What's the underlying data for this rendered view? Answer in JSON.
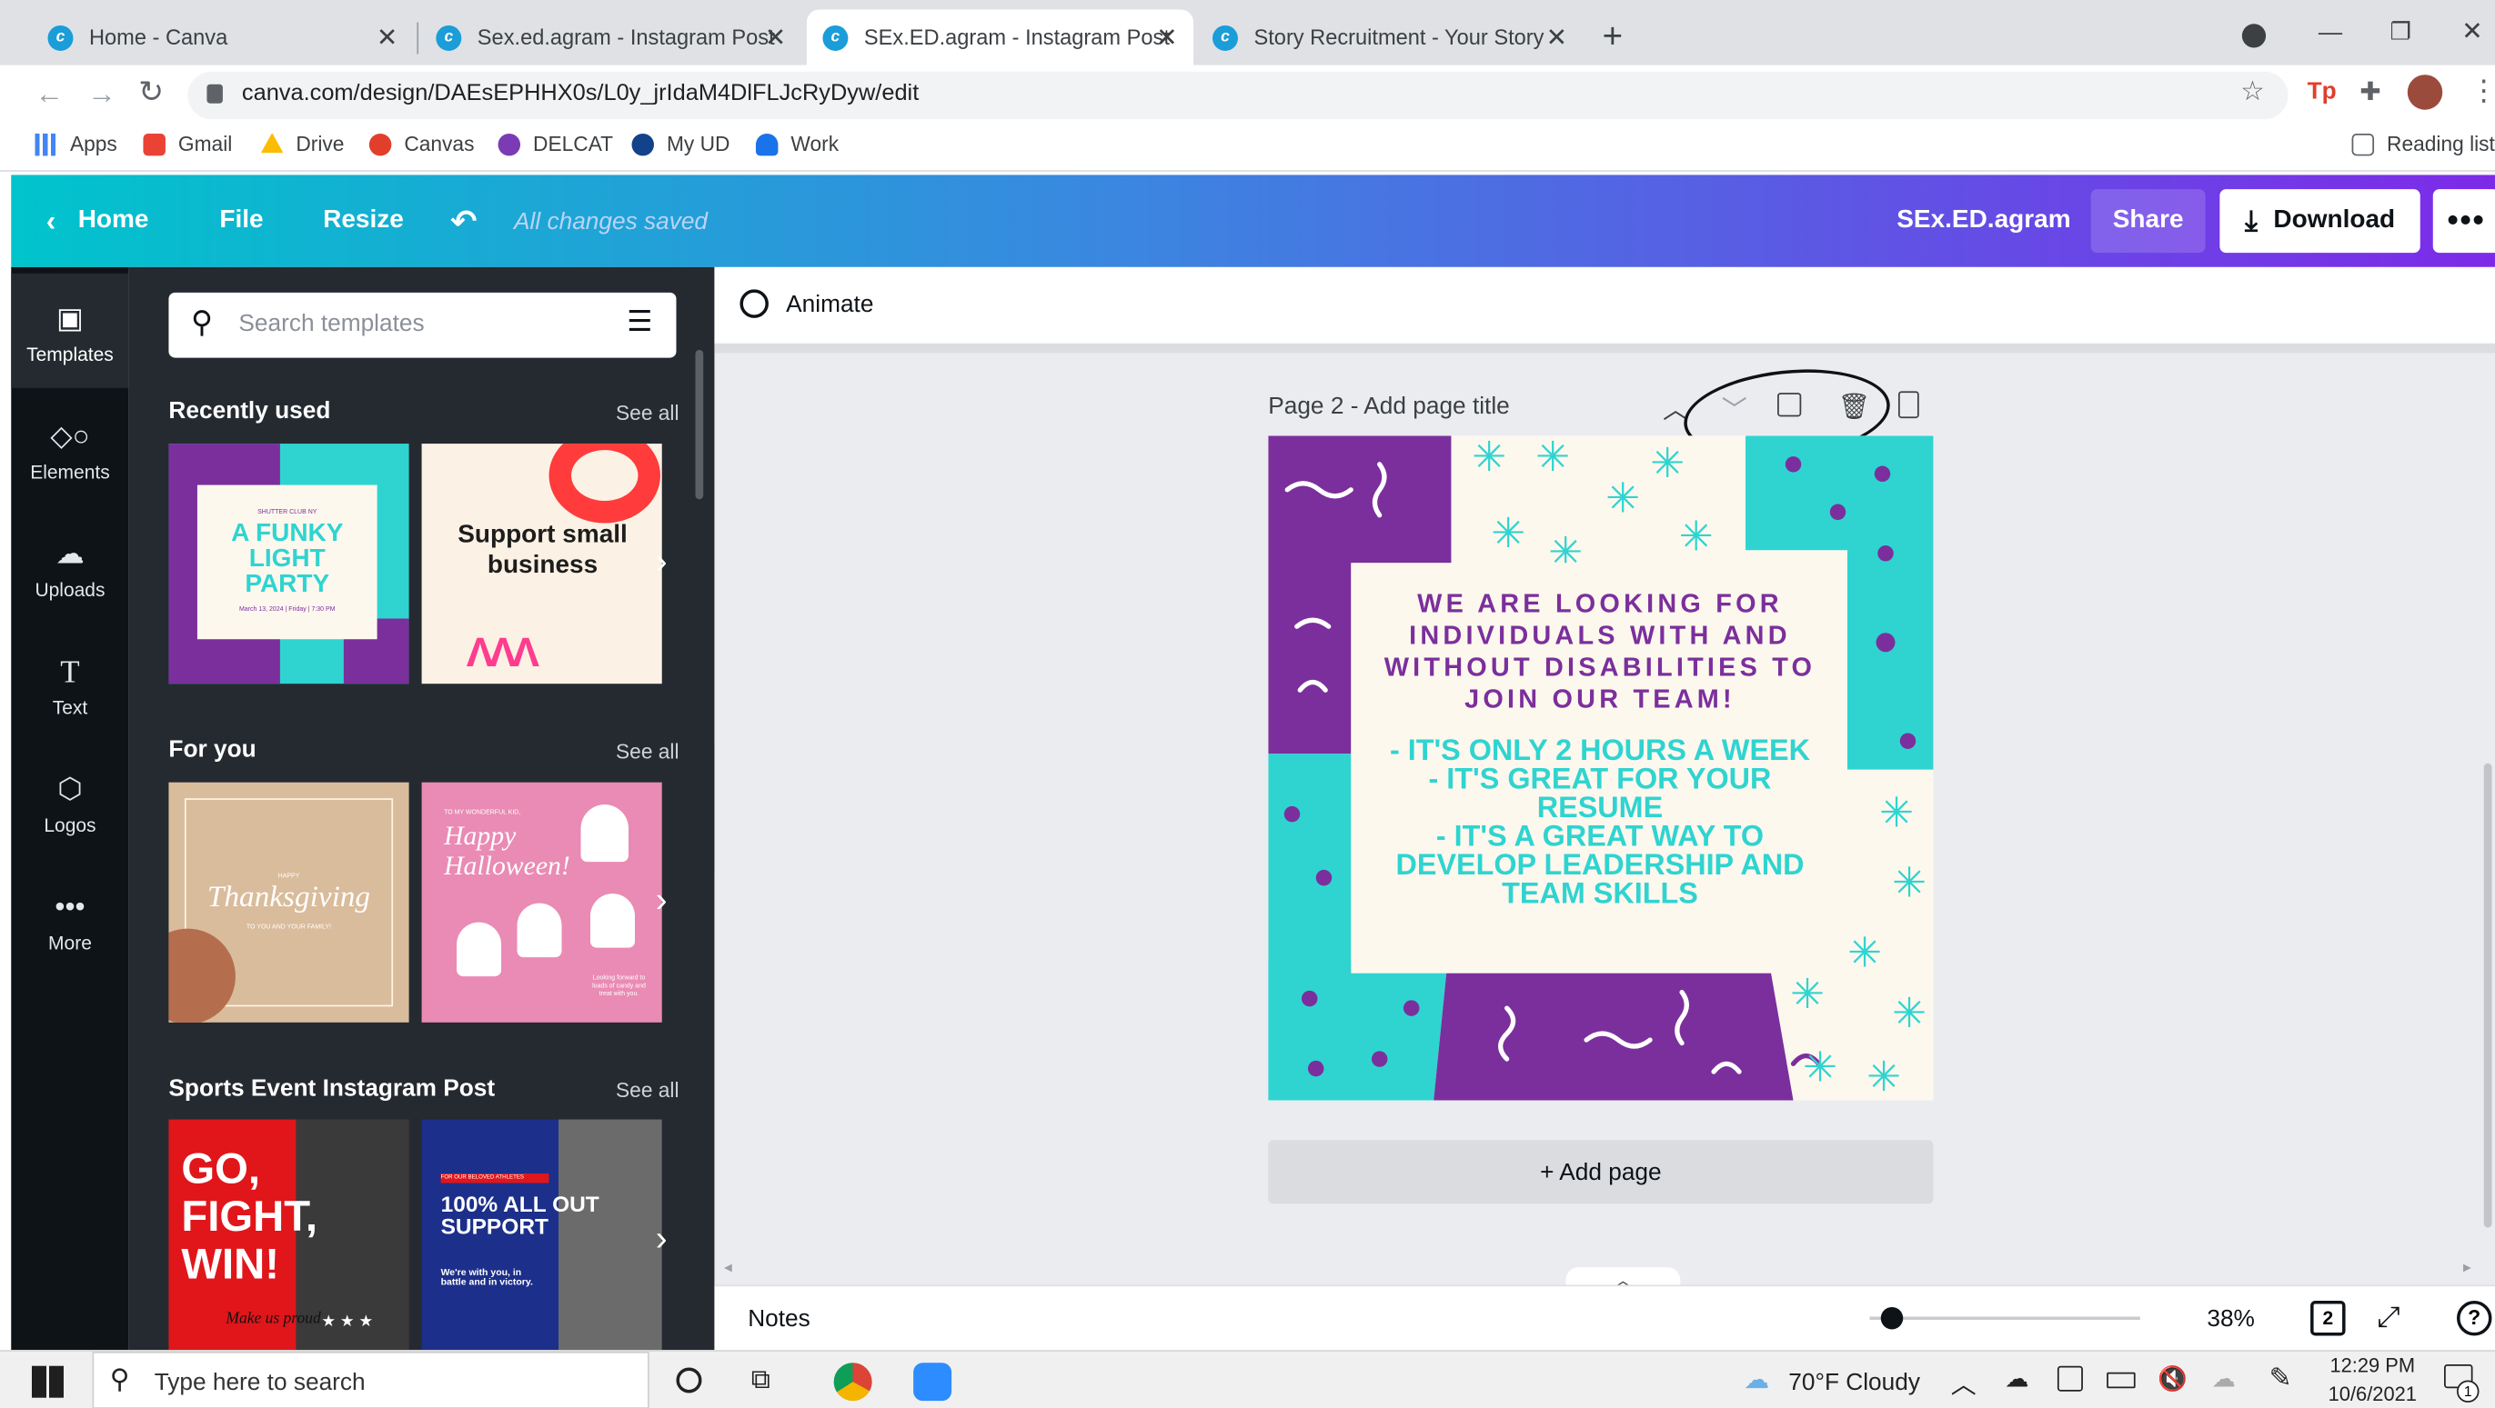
{
  "tabs": [
    {
      "title": "Home - Canva"
    },
    {
      "title": "Sex.ed.agram - Instagram Post"
    },
    {
      "title": "SEx.ED.agram - Instagram Post"
    },
    {
      "title": "Story Recruitment - Your Story"
    }
  ],
  "address": {
    "url": "canva.com/design/DAEsEPHHX0s/L0y_jrIdaM4DlFLJcRyDyw/edit"
  },
  "bookmarks": {
    "items": [
      "Apps",
      "Gmail",
      "Drive",
      "Canvas",
      "DELCAT",
      "My UD",
      "Work"
    ],
    "reading_list": "Reading list"
  },
  "header": {
    "home": "Home",
    "file": "File",
    "resize": "Resize",
    "saved": "All changes saved",
    "design_title": "SEx.ED.agram",
    "share": "Share",
    "download": "Download"
  },
  "rail": [
    "Templates",
    "Elements",
    "Uploads",
    "Text",
    "Logos",
    "More"
  ],
  "panel": {
    "search_placeholder": "Search templates",
    "sections": [
      {
        "title": "Recently used",
        "see_all": "See all"
      },
      {
        "title": "For you",
        "see_all": "See all"
      },
      {
        "title": "Sports Event Instagram Post",
        "see_all": "See all"
      }
    ],
    "thumbs": {
      "funky_small": "SHUTTER CLUB NY",
      "funky": "A FUNKY LIGHT PARTY",
      "funky_date": "March 13, 2024 | Friday | 7:30 PM",
      "support": "Support small business",
      "thanks_top": "HAPPY",
      "thanks": "Thanksgiving",
      "thanks_bottom": "TO YOU AND YOUR FAMILY!",
      "halloween_top": "TO MY WONDERFUL KID,",
      "halloween": "Happy Halloween!",
      "halloween_bottom": "Looking forward to loads of candy and treat with you.",
      "gofight": "GO, FIGHT, WIN!",
      "make_proud": "Make us proud",
      "allout_tag": "FOR OUR BELOVED ATHLETES",
      "allout": "100% ALL OUT SUPPORT",
      "allout_sub": "We're with you, in battle and in victory."
    }
  },
  "canvas": {
    "animate": "Animate",
    "page_label": "Page 2",
    "page_title": "- Add page title",
    "add_page": "+ Add page",
    "headline": "WE ARE LOOKING FOR INDIVIDUALS WITH AND WITHOUT DISABILITIES TO JOIN OUR TEAM!",
    "bullets": [
      "- IT'S ONLY 2 HOURS A WEEK",
      "- IT'S GREAT FOR YOUR RESUME",
      "- IT'S A GREAT WAY TO DEVELOP LEADERSHIP AND TEAM SKILLS"
    ]
  },
  "footer": {
    "notes": "Notes",
    "zoom": "38%",
    "page_count": "2",
    "zoom_fraction": 0.04
  },
  "taskbar": {
    "search_placeholder": "Type here to search",
    "weather": "70°F  Cloudy",
    "time": "12:29 PM",
    "date": "10/6/2021",
    "notif_count": "1"
  },
  "colors": {
    "purple": "#7b2f9c",
    "teal": "#2fd4d0",
    "canva_teal": "#00c4cc",
    "canva_purple": "#7d2ae8"
  }
}
